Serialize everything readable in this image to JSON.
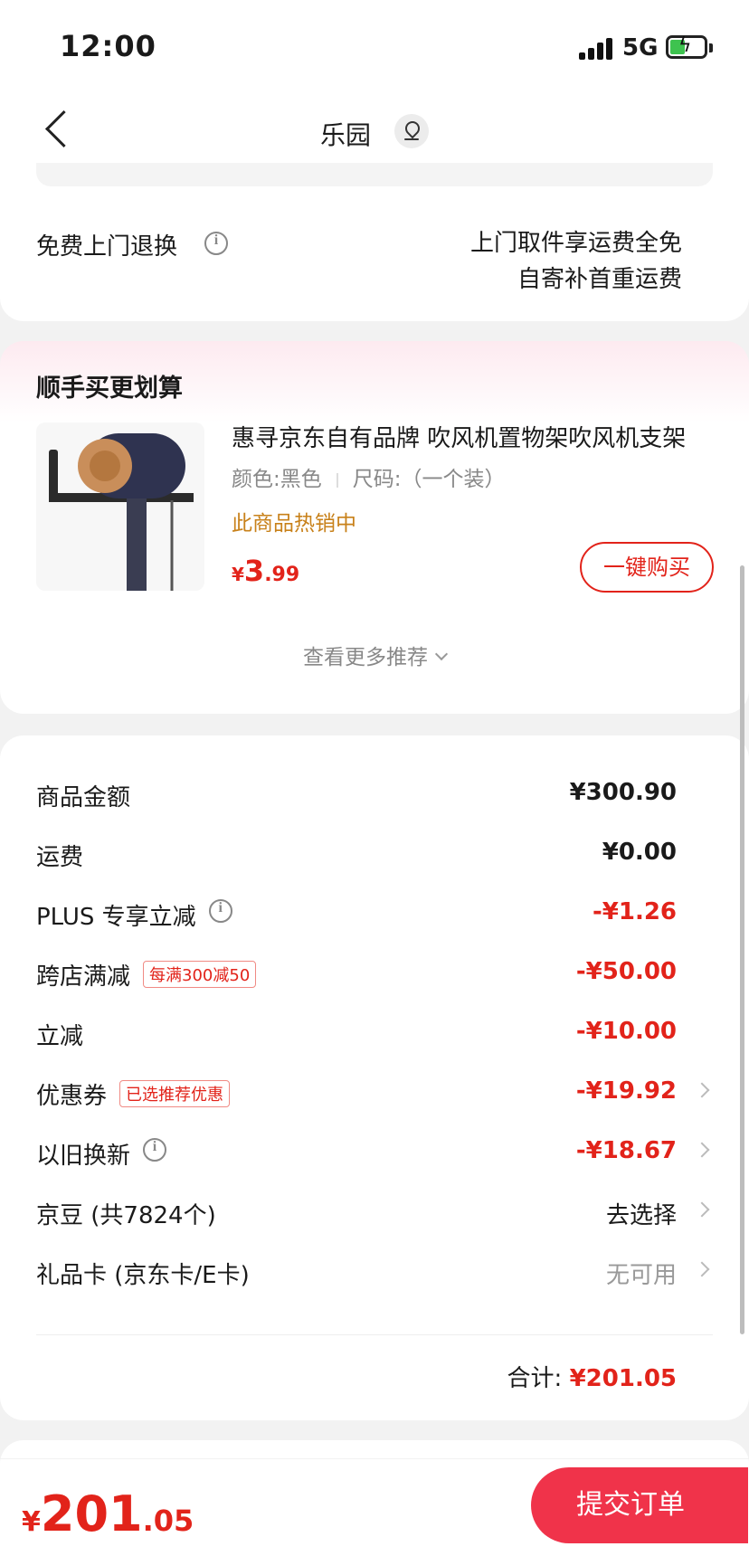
{
  "status_bar": {
    "time": "12:00",
    "network": "5G"
  },
  "nav": {
    "title": "乐园"
  },
  "return_service": {
    "label": "免费上门退换",
    "line1": "上门取件享运费全免",
    "line2": "自寄补首重运费"
  },
  "recommend": {
    "title": "顺手买更划算",
    "product": {
      "name": "惠寻京东自有品牌 吹风机置物架吹风机支架",
      "color": "颜色:黑色",
      "size": "尺码:（一个装）",
      "hot_label": "此商品热销中",
      "price_symbol": "¥",
      "price_int": "3",
      "price_dec": ".99",
      "buy_label": "一键购买"
    },
    "more_label": "查看更多推荐"
  },
  "summary": {
    "rows": [
      {
        "label": "商品金额",
        "value": "¥300.90"
      },
      {
        "label": "运费",
        "value": "¥0.00"
      },
      {
        "label": "PLUS 专享立减",
        "value": "-¥1.26"
      },
      {
        "label": "跨店满减",
        "tag": "每满300减50",
        "value": "-¥50.00"
      },
      {
        "label": "立减",
        "value": "-¥10.00"
      },
      {
        "label": "优惠券",
        "tag": "已选推荐优惠",
        "value": "-¥19.92"
      },
      {
        "label": "以旧换新",
        "value": "-¥18.67"
      },
      {
        "label": "京豆 (共7824个)",
        "value": "去选择"
      },
      {
        "label": "礼品卡 (京东卡/E卡)",
        "value": "无可用"
      }
    ],
    "total_label": "合计:",
    "total_value": "¥201.05"
  },
  "bottom_bar": {
    "price_symbol": "¥",
    "price_int": "201",
    "price_dec": ".05",
    "submit_label": "提交订单"
  },
  "colors": {
    "accent": "#e2231a",
    "hot": "#c8811a",
    "submit_bg": "#f0334a"
  }
}
